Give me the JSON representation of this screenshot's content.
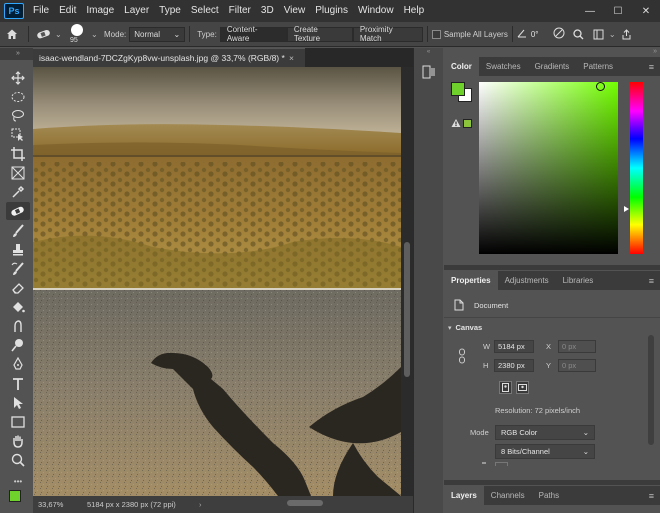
{
  "app": {
    "logo": "Ps"
  },
  "menu": [
    "File",
    "Edit",
    "Image",
    "Layer",
    "Type",
    "Select",
    "Filter",
    "3D",
    "View",
    "Plugins",
    "Window",
    "Help"
  ],
  "window_controls": {
    "minimize": "—",
    "maximize": "☐",
    "close": "✕"
  },
  "options": {
    "brush_size": "95",
    "mode_label": "Mode:",
    "mode_value": "Normal",
    "type_label": "Type:",
    "type_buttons": [
      "Content-Aware",
      "Create Texture",
      "Proximity Match"
    ],
    "sample_all_layers": "Sample All Layers",
    "angle_value": "0°"
  },
  "document": {
    "tab_title": "isaac-wendland-7DCZgKyp8vw-unsplash.jpg @ 33,7% (RGB/8) *",
    "close_glyph": "×",
    "zoom": "33,67%",
    "info": "5184 px x 2380 px (72 ppi)",
    "arrow": "›"
  },
  "color_panel": {
    "tabs": [
      "Color",
      "Swatches",
      "Gradients",
      "Patterns"
    ],
    "active_tab": "Color",
    "foreground": "#6fd12b",
    "background": "#ffffff",
    "picker_hue": "#73ff00"
  },
  "properties_panel": {
    "tabs": [
      "Properties",
      "Adjustments",
      "Libraries"
    ],
    "active_tab": "Properties",
    "type_label": "Document",
    "section": "Canvas",
    "w_label": "W",
    "w_value": "5184 px",
    "h_label": "H",
    "h_value": "2380 px",
    "x_label": "X",
    "x_value": "0 px",
    "y_label": "Y",
    "y_value": "0 px",
    "resolution": "Resolution: 72 pixels/inch",
    "mode_label": "Mode",
    "mode_value": "RGB Color",
    "depth_value": "8 Bits/Channel"
  },
  "layers_panel": {
    "tabs": [
      "Layers",
      "Channels",
      "Paths"
    ],
    "active_tab": "Layers"
  }
}
